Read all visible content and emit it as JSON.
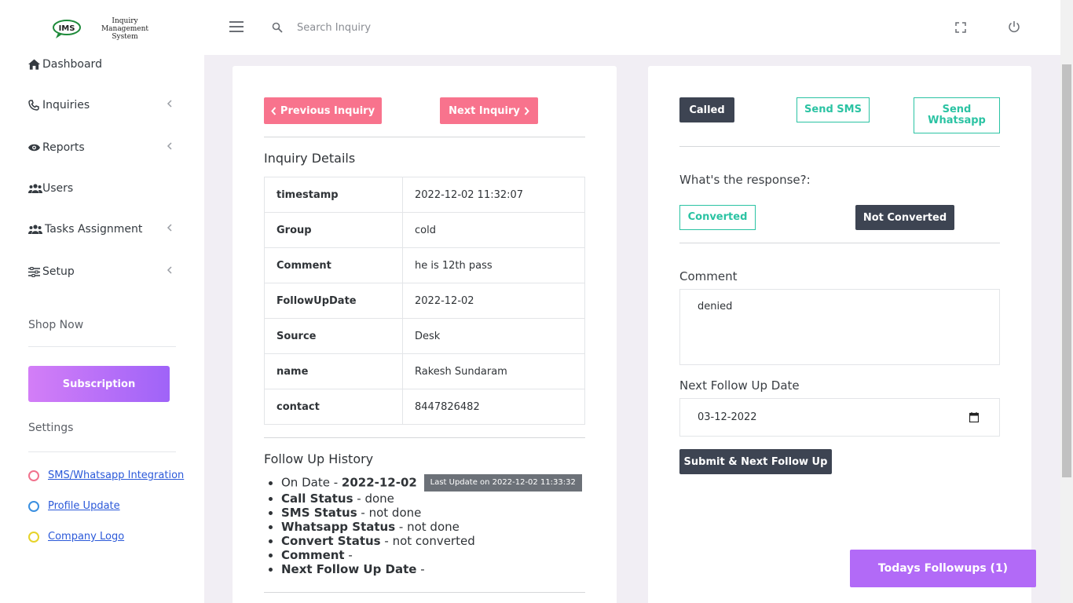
{
  "brand": {
    "logo_text": "IMS",
    "name_line1": "Inquiry Management",
    "name_line2": "System"
  },
  "sidebar": {
    "items": [
      {
        "label": "Dashboard",
        "icon": "home-icon",
        "has_submenu": false
      },
      {
        "label": "Inquiries",
        "icon": "phone-icon",
        "has_submenu": true
      },
      {
        "label": "Reports",
        "icon": "eye-icon",
        "has_submenu": true
      },
      {
        "label": "Users",
        "icon": "users-icon",
        "has_submenu": false
      },
      {
        "label": "Tasks Assignment",
        "icon": "users-icon",
        "has_submenu": true
      },
      {
        "label": "Setup",
        "icon": "sliders-icon",
        "has_submenu": true
      }
    ],
    "shop_title": "Shop Now",
    "subscription_label": "Subscription",
    "settings_title": "Settings",
    "settings_links": [
      {
        "label": "SMS/Whatsapp Integration",
        "color": "#f1728d"
      },
      {
        "label": "Profile Update",
        "color": "#3a8fe0"
      },
      {
        "label": "Company Logo",
        "color": "#e6d32a"
      }
    ]
  },
  "topbar": {
    "search_placeholder": "Search Inquiry"
  },
  "inquiry": {
    "prev_label": "Previous Inquiry",
    "next_label": "Next Inquiry",
    "details_title": "Inquiry Details",
    "details": [
      {
        "key": "timestamp",
        "value": "2022-12-02 11:32:07"
      },
      {
        "key": "Group",
        "value": "cold"
      },
      {
        "key": "Comment",
        "value": "he is 12th pass"
      },
      {
        "key": "FollowUpDate",
        "value": "2022-12-02"
      },
      {
        "key": "Source",
        "value": "Desk"
      },
      {
        "key": "name",
        "value": "Rakesh Sundaram"
      },
      {
        "key": "contact",
        "value": "8447826482"
      }
    ],
    "history_title": "Follow Up History",
    "history": {
      "on_date_label": "On Date",
      "on_date": "2022-12-02",
      "last_update": "Last Update on 2022-12-02 11:33:32",
      "call_status_label": "Call Status",
      "call_status": "done",
      "sms_status_label": "SMS Status",
      "sms_status": "not done",
      "whatsapp_status_label": "Whatsapp Status",
      "whatsapp_status": "not done",
      "convert_status_label": "Convert Status",
      "convert_status": "not converted",
      "comment_label": "Comment",
      "comment": "",
      "next_date_label": "Next Follow Up Date",
      "next_date": ""
    }
  },
  "followup": {
    "called_label": "Called",
    "send_sms_label": "Send SMS",
    "send_whatsapp_line1": "Send",
    "send_whatsapp_line2": "Whatsapp",
    "response_label": "What's the response?:",
    "converted_label": "Converted",
    "not_converted_label": "Not Converted",
    "comment_label": "Comment",
    "comment_value": "denied",
    "next_date_label": "Next Follow Up Date",
    "next_date_value": "03-12-2022",
    "submit_label": "Submit & Next Follow Up",
    "todays_label": "Todays Followups (1)"
  },
  "colors": {
    "pink": "#f8738d",
    "dark": "#3d4452",
    "teal": "#2bc3a3",
    "purple": "#b26af7"
  }
}
